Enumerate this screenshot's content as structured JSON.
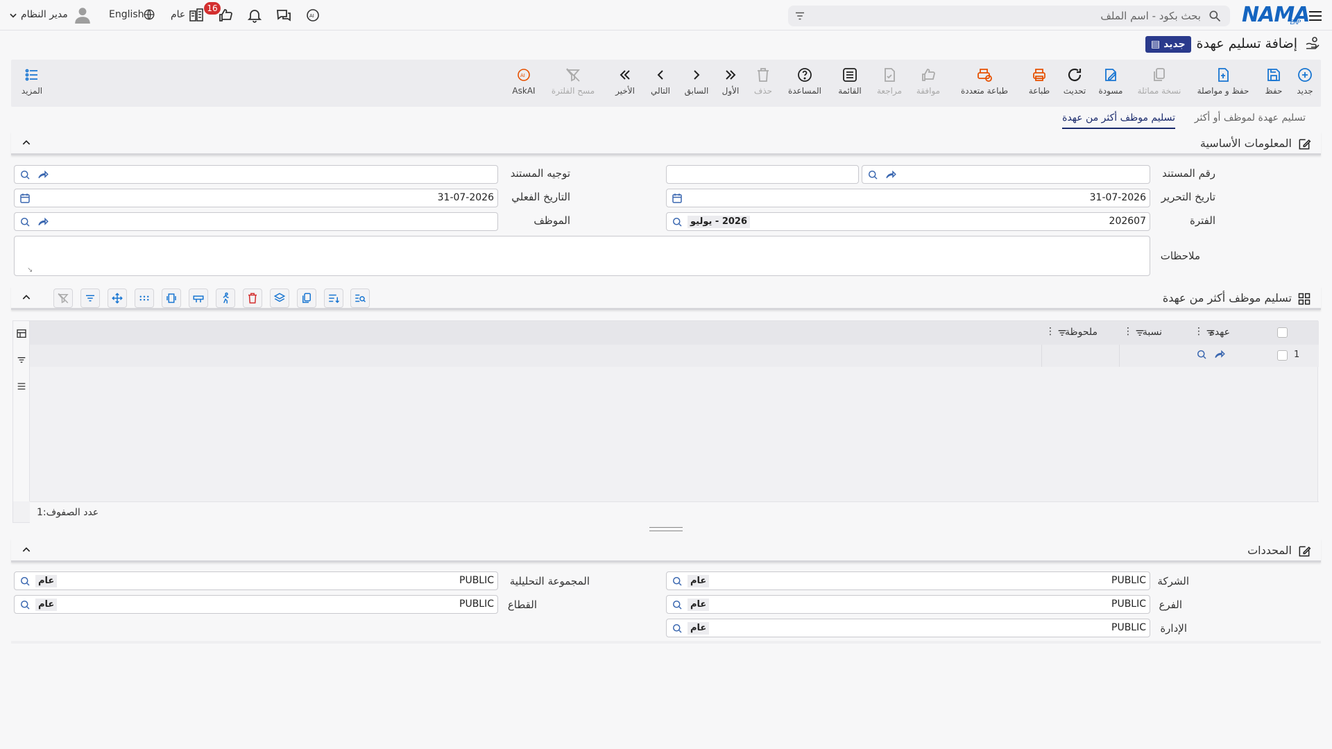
{
  "topbar": {
    "search_placeholder": "بحث بكود - اسم الملف",
    "logo": "NAMA",
    "logo_sub": "ERP",
    "language": "English",
    "company_label": "عام",
    "notifications_count": "16",
    "user_name": "مدير النظام"
  },
  "header": {
    "title": "إضافة تسليم عهدة",
    "badge": "جديد"
  },
  "toolbar": [
    {
      "name": "new",
      "label": "جديد",
      "icon": "plus-circle-icon"
    },
    {
      "name": "save",
      "label": "حفظ",
      "icon": "save-icon"
    },
    {
      "name": "save-continue",
      "label": "حفظ و مواصلة",
      "icon": "save-continue-icon"
    },
    {
      "name": "duplicate",
      "label": "نسخة مماثلة",
      "icon": "copy-icon"
    },
    {
      "name": "draft",
      "label": "مسودة",
      "icon": "draft-icon"
    },
    {
      "name": "refresh",
      "label": "تحديث",
      "icon": "refresh-icon"
    },
    {
      "name": "print",
      "label": "طباعة",
      "icon": "print-icon"
    },
    {
      "name": "multi-print",
      "label": "طباعة متعددة",
      "icon": "multi-print-icon"
    },
    {
      "name": "approve",
      "label": "موافقة",
      "icon": "thumbs-up-icon"
    },
    {
      "name": "review",
      "label": "مراجعة",
      "icon": "review-icon"
    },
    {
      "name": "list",
      "label": "القائمة",
      "icon": "list-icon"
    },
    {
      "name": "help",
      "label": "المساعدة",
      "icon": "help-icon"
    },
    {
      "name": "delete",
      "label": "حذف",
      "icon": "trash-icon"
    },
    {
      "name": "first",
      "label": "الأول",
      "icon": "first-icon"
    },
    {
      "name": "previous",
      "label": "السابق",
      "icon": "previous-icon"
    },
    {
      "name": "next",
      "label": "التالي",
      "icon": "next-icon"
    },
    {
      "name": "last",
      "label": "الأخير",
      "icon": "last-icon"
    },
    {
      "name": "clear-filter",
      "label": "مسح الفلترة",
      "icon": "clear-filter-icon"
    },
    {
      "name": "askai",
      "label": "AskAI",
      "icon": "ai-icon"
    }
  ],
  "more_label": "المزيد",
  "tabs": [
    {
      "label": "تسليم عهدة لموظف أو أكثر"
    },
    {
      "label": "تسليم موظف أكثر من عهدة"
    }
  ],
  "basic_info": {
    "title": "المعلومات الأساسية",
    "doc_number_label": "رقم المستند",
    "doc_direction_label": "توجيه المستند",
    "edit_date_label": "تاريخ التحرير",
    "edit_date_value": "31-07-2026",
    "actual_date_label": "التاريخ الفعلي",
    "actual_date_value": "31-07-2026",
    "period_label": "الفترة",
    "period_value": "202607",
    "period_chip": "2026 - يوليو",
    "employee_label": "الموظف",
    "notes_label": "ملاحظات"
  },
  "grid_section": {
    "title": "تسليم موظف أكثر من عهدة",
    "columns": [
      "عهدة",
      "نسبة",
      "ملحوظة"
    ],
    "row_number": "1",
    "footer_label": "عدد الصفوف:",
    "footer_count": "1"
  },
  "dimensions": {
    "title": "المحددات",
    "company_label": "الشركة",
    "company_value": "PUBLIC",
    "company_chip": "عام",
    "branch_label": "الفرع",
    "branch_value": "PUBLIC",
    "branch_chip": "عام",
    "department_label": "الإدارة",
    "department_value": "PUBLIC",
    "department_chip": "عام",
    "analytic_label": "المجموعة التحليلية",
    "analytic_value": "PUBLIC",
    "analytic_chip": "عام",
    "sector_label": "القطاع",
    "sector_value": "PUBLIC",
    "sector_chip": "عام"
  }
}
